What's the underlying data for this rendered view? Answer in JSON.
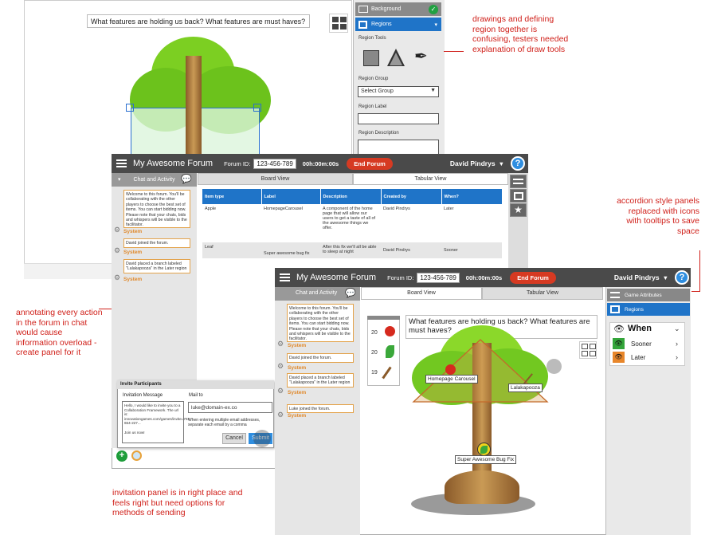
{
  "annotations": {
    "draw_tools": "drawings and defining region together is confusing, testers needed explanation of draw tools",
    "accordion": "accordion style panels replaced with icons with tooltips to save space",
    "annotating": "annotating every action in the forum in chat would cause information overload - create panel for it",
    "invitation": "invitation panel is in right place and feels right but need options for methods of sending"
  },
  "back_board": {
    "question": "What features are holding us back? What features are must haves?"
  },
  "region_panel": {
    "background_label": "Background",
    "regions_label": "Regions",
    "region_tools_label": "Region Tools",
    "region_group_label": "Region Group",
    "select_group": "Select Group",
    "region_label_label": "Region Label",
    "region_description_label": "Region Description"
  },
  "forum1": {
    "title": "My Awesome Forum",
    "forum_id_label": "Forum ID:",
    "forum_id": "123-456-789",
    "timer": "00h:00m:00s",
    "end_forum": "End Forum",
    "user": "David Pindrys",
    "help": "?",
    "chat_title": "Chat and Activity",
    "tabs": [
      "Board View",
      "Tabular View"
    ],
    "table_headers": [
      "Item type",
      "Label",
      "Description",
      "Created by",
      "When?"
    ],
    "table_rows": [
      [
        "Apple",
        "HomepageCarousel",
        "A component of the home page that will allow our users to get a taste of all of the awesome things we offer.",
        "David Pindrys",
        "Later"
      ],
      [
        "Leaf",
        "Super awesome bug fix",
        "After this fix we'll all be able to sleep at night",
        "David Pindrys",
        "Sooner"
      ]
    ],
    "messages": [
      "Welcome to this forum. You'll be collaborating with the other players to choose the best set of items. You can start bidding now. Please note that your chats, bids and whispers will be visible to the facilitator.",
      "David joined the forum.",
      "David placed a branch labeled \"Lalakapooza\" in the Later region"
    ],
    "system_label": "System",
    "invite": {
      "title": "Invite Participants",
      "message_label": "Invitation Message",
      "mail_label": "Mail to",
      "message_text": "Hello, I would like to invite you to a Collaboration Framework. The url is: innovationgames.com/games/invite=781-654-227...",
      "join": "Join us now!",
      "mail_value": "luke@domain-ex.co",
      "hint": "When entering multiple email addresses, separate each email by a comma",
      "cancel": "Cancel",
      "submit": "Submit"
    }
  },
  "forum2": {
    "title": "My Awesome Forum",
    "forum_id_label": "Forum ID:",
    "forum_id": "123-456-789",
    "timer": "00h:00m:00s",
    "end_forum": "End Forum",
    "user": "David Pindrys",
    "help": "?",
    "chat_title": "Chat and Activity",
    "tabs": [
      "Board View",
      "Tabular View"
    ],
    "question": "What features are holding us back? What features are must haves?",
    "palette_counts": [
      "20",
      "20",
      "19"
    ],
    "messages": [
      "Welcome to this forum. You'll be collaborating with the other players to choose the best set of items. You can start bidding now. Please note that your chats, bids and whispers will be visible to the facilitator.",
      "David joined the forum.",
      "David placed a branch labeled \"Lalakapooza\" in the Later region",
      "Luke joined the forum."
    ],
    "system_label": "System",
    "tree_labels": [
      "Homepage Carousel",
      "Lalakapooza",
      "Super Awesome Bug Fix"
    ],
    "side": {
      "game_attributes": "Game Attributes",
      "regions": "Regions",
      "when": "When",
      "sooner": "Sooner",
      "later": "Later"
    }
  }
}
